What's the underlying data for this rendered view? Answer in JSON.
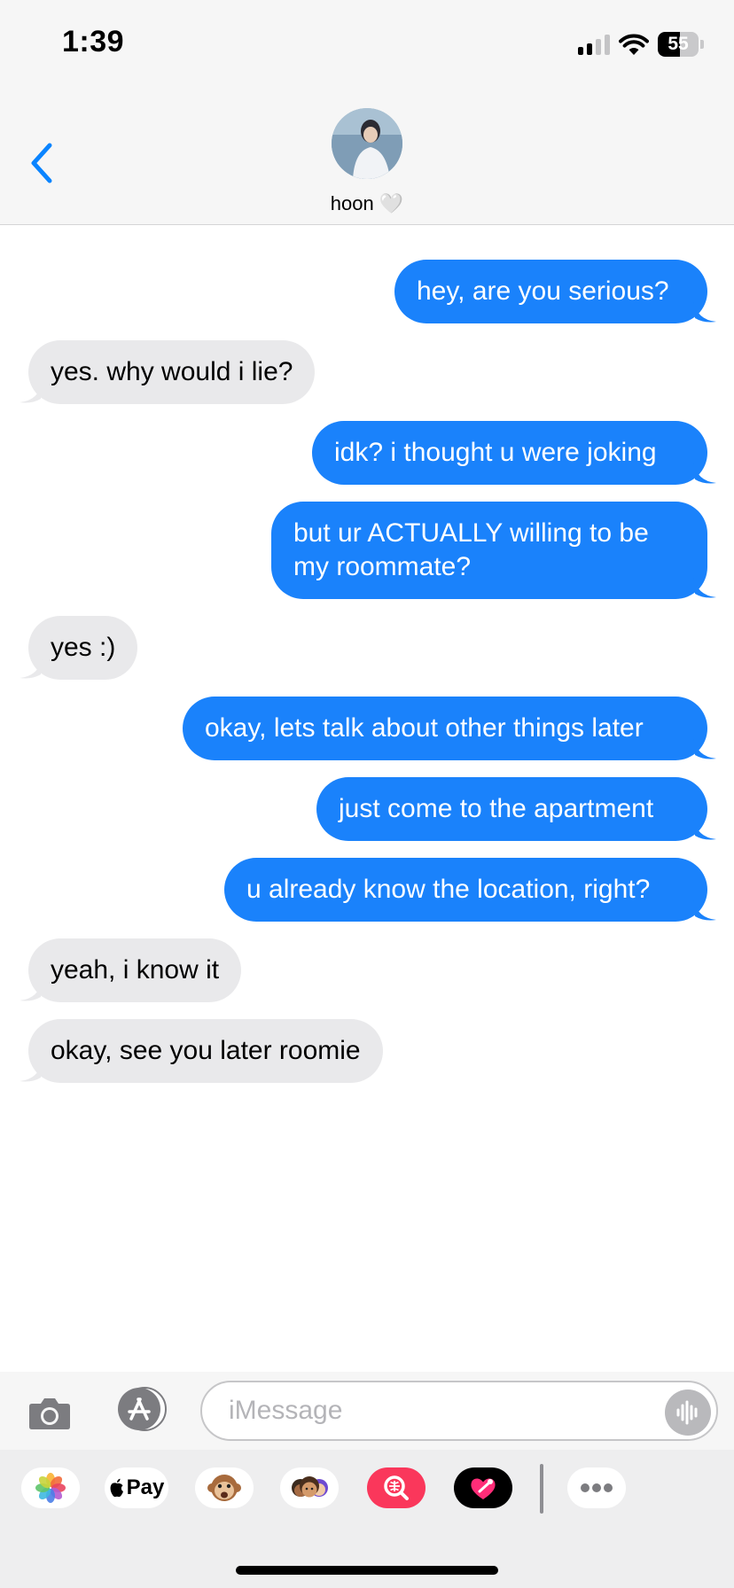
{
  "status_bar": {
    "time": "1:39",
    "battery": "55",
    "battery_level": 0.55
  },
  "contact": {
    "name": "hoon 🤍"
  },
  "messages": [
    {
      "side": "sent",
      "text": "hey, are you serious?"
    },
    {
      "side": "recv",
      "text": "yes. why would i lie?"
    },
    {
      "side": "sent",
      "text": "idk? i thought u were joking"
    },
    {
      "side": "sent",
      "text": "but ur ACTUALLY willing to be\nmy roommate?"
    },
    {
      "side": "recv",
      "text": "yes :)"
    },
    {
      "side": "sent",
      "text": "okay, lets talk about other things later"
    },
    {
      "side": "sent",
      "text": "just come to the apartment"
    },
    {
      "side": "sent",
      "text": "u already know the location, right?"
    },
    {
      "side": "recv",
      "text": "yeah, i know it"
    },
    {
      "side": "recv",
      "text": "okay, see you later roomie"
    }
  ],
  "compose": {
    "placeholder": "iMessage"
  },
  "apps": {
    "applepay_label": "Pay",
    "items": [
      "photos-icon",
      "apple-pay-icon",
      "monkey-memoji-icon",
      "memoji-stickers-icon",
      "images-search-icon",
      "digital-touch-icon",
      "more-apps-icon"
    ]
  },
  "colors": {
    "sent_bubble": "#1a82fb",
    "received_bubble": "#e9e9eb",
    "accent": "#0a84ff"
  }
}
